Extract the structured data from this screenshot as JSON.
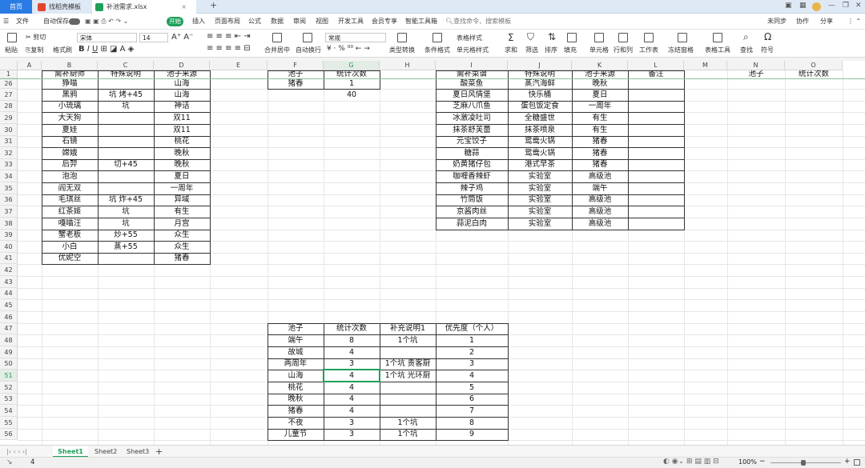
{
  "titlebar": {
    "home": "首页",
    "tab_template": "找稻壳模板",
    "tab_file": "补池需求.xlsx",
    "new_tab": "+"
  },
  "menu": {
    "file": "文件",
    "autosave": "自动保存",
    "start": "开始",
    "items": [
      "插入",
      "页面布局",
      "公式",
      "数据",
      "审阅",
      "视图",
      "开发工具",
      "会员专享",
      "智能工具箱"
    ],
    "search": "查找命令、搜索模板",
    "sync": "未同步",
    "collab": "协作",
    "share": "分享"
  },
  "toolbar": {
    "paste": "粘贴",
    "cut": "剪切",
    "copy": "复制",
    "format_painter": "格式刷",
    "font": "宋体",
    "size": "14",
    "number_format": "常规",
    "merge": "合并居中",
    "wrap": "自动换行",
    "convert": "类型转换",
    "cond_format": "条件格式",
    "table_style": "表格样式",
    "cell_style": "单元格样式",
    "sum": "求和",
    "filter": "筛选",
    "sort": "排序",
    "fill": "填充",
    "cell": "单元格",
    "rowcol": "行和列",
    "sheet": "工作表",
    "freeze": "冻结窗格",
    "table_tool": "表格工具",
    "find": "查找",
    "symbol": "符号"
  },
  "columns": [
    "A",
    "B",
    "C",
    "D",
    "E",
    "F",
    "G",
    "H",
    "I",
    "J",
    "K",
    "L",
    "M",
    "N",
    "O"
  ],
  "rows": [
    "1",
    "26",
    "27",
    "28",
    "29",
    "30",
    "31",
    "32",
    "33",
    "34",
    "35",
    "36",
    "37",
    "38",
    "39",
    "40",
    "41",
    "42",
    "43",
    "44",
    "45",
    "46",
    "47",
    "48",
    "49",
    "50",
    "51",
    "52",
    "53",
    "54",
    "55",
    "56"
  ],
  "table1": {
    "headers": [
      "需补厨师",
      "特殊说明",
      "池子来源"
    ],
    "rows": [
      [
        "狰喵",
        "",
        "山海"
      ],
      [
        "黑鸦",
        "坑 烤+45",
        "山海"
      ],
      [
        "小琉璃",
        "坑",
        "神话"
      ],
      [
        "大天狗",
        "",
        "双11"
      ],
      [
        "夏娃",
        "",
        "双11"
      ],
      [
        "石镜",
        "",
        "桃花"
      ],
      [
        "嫦娥",
        "",
        "晚秋"
      ],
      [
        "后羿",
        "切+45",
        "晚秋"
      ],
      [
        "泡泡",
        "",
        "夏日"
      ],
      [
        "阎无双",
        "",
        "一周年"
      ],
      [
        "毛琪丝",
        "坑 炸+45",
        "异域"
      ],
      [
        "红茶姬",
        "坑",
        "有生"
      ],
      [
        "嘎喵汪",
        "坑",
        "月宫"
      ],
      [
        "蟹老板",
        "炒+55",
        "众生"
      ],
      [
        "小白",
        "蒸+55",
        "众生"
      ],
      [
        "优妮空",
        "",
        "猪春"
      ]
    ]
  },
  "table2": {
    "headers": [
      "池子",
      "统计次数"
    ],
    "rows": [
      [
        "猪春",
        "1"
      ]
    ],
    "total": "40"
  },
  "table3": {
    "headers": [
      "需补菜谱",
      "特殊说明",
      "池子来源",
      "备注"
    ],
    "rows": [
      [
        "酸菜鱼",
        "蒸汽海鲜",
        "晚秋",
        ""
      ],
      [
        "夏日风情堡",
        "快乐桶",
        "夏日",
        ""
      ],
      [
        "芝麻八爪鱼",
        "蛋包饭定食",
        "一周年",
        ""
      ],
      [
        "冰激凌吐司",
        "全糖盛世",
        "有生",
        ""
      ],
      [
        "抹茶舒芙蕾",
        "抹茶喷泉",
        "有生",
        ""
      ],
      [
        "元宝饺子",
        "鸳鸯火锅",
        "猪春",
        ""
      ],
      [
        "糖蒜",
        "鸳鸯火锅",
        "猪春",
        ""
      ],
      [
        "奶黄猪仔包",
        "港式早茶",
        "猪春",
        ""
      ],
      [
        "咖喱香辣虾",
        "实验室",
        "高级池",
        ""
      ],
      [
        "辣子鸡",
        "实验室",
        "端午",
        ""
      ],
      [
        "竹筒饭",
        "实验室",
        "高级池",
        ""
      ],
      [
        "京酱肉丝",
        "实验室",
        "高级池",
        ""
      ],
      [
        "蒜泥白肉",
        "实验室",
        "高级池",
        ""
      ]
    ]
  },
  "table4": {
    "headers": [
      "池子",
      "统计次数"
    ]
  },
  "table5": {
    "headers": [
      "池子",
      "统计次数",
      "补充说明1",
      "优先度（个人）"
    ],
    "rows": [
      [
        "端午",
        "8",
        "1个坑",
        "1"
      ],
      [
        "故城",
        "4",
        "",
        "2"
      ],
      [
        "两周年",
        "3",
        "1个坑 贵客厨",
        "3"
      ],
      [
        "山海",
        "4",
        "1个坑 光环厨",
        "4"
      ],
      [
        "桃花",
        "4",
        "",
        "5"
      ],
      [
        "晚秋",
        "4",
        "",
        "6"
      ],
      [
        "猪春",
        "4",
        "",
        "7"
      ],
      [
        "不夜",
        "3",
        "1个坑",
        "8"
      ],
      [
        "儿童节",
        "3",
        "1个坑",
        "9"
      ]
    ]
  },
  "sheets": [
    "Sheet1",
    "Sheet2",
    "Sheet3"
  ],
  "status": {
    "count": "4",
    "zoom": "100%"
  }
}
